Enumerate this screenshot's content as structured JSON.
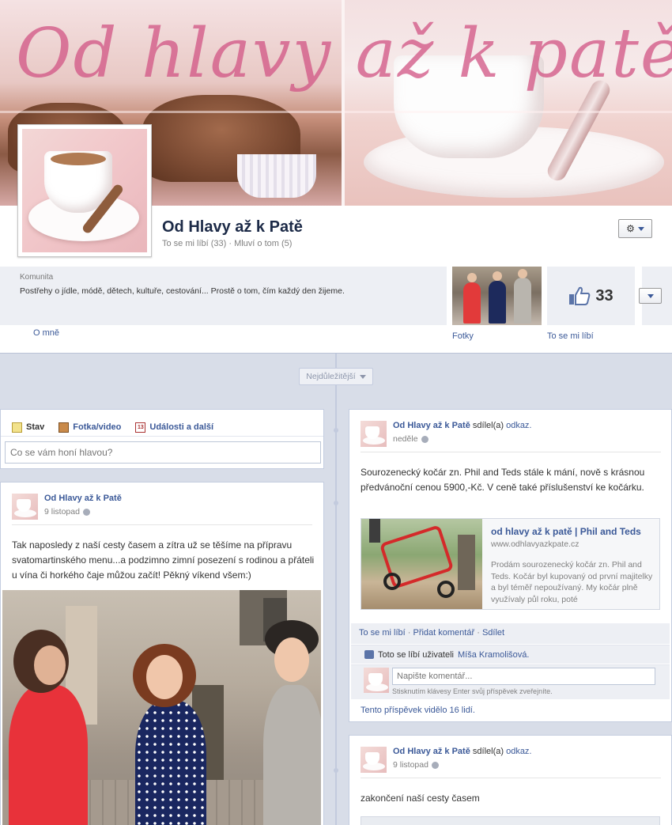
{
  "cover": {
    "title": "Od hlavy až k patě"
  },
  "page": {
    "name": "Od Hlavy až k Patě",
    "stats": "To se mi líbí (33) · Mluví o tom (5)",
    "category": "Komunita",
    "about": "Postřehy o jídle, módě, dětech, kultuře, cestování... Prostě o tom, čím každý den žijeme.",
    "about_link": "O mně",
    "photos_label": "Fotky",
    "likes_count": "33",
    "likes_label": "To se mi líbí",
    "gear_icon": "gear-icon"
  },
  "timeline": {
    "filter": "Nejdůležitější"
  },
  "composer": {
    "tabs": [
      {
        "label": "Stav",
        "icon": "status-icon"
      },
      {
        "label": "Fotka/video",
        "icon": "photo-icon"
      },
      {
        "label": "Události a další",
        "icon": "calendar-icon",
        "badge": "13"
      }
    ],
    "placeholder": "Co se vám honí hlavou?"
  },
  "posts": [
    {
      "author": "Od Hlavy až k Patě",
      "date": "9 listopad",
      "text": "Tak naposledy z naší cesty časem a zítra už se těšíme na přípravu svatomartinského menu...a podzimno zimní posezení s rodinou a přáteli u vína či horkého čaje můžou začít! Pěkný víkend všem:)"
    },
    {
      "author": "Od Hlavy až k Patě",
      "shared": "sdílel(a)",
      "shared_link": "odkaz.",
      "date": "neděle",
      "text": "Sourozenecký kočár zn. Phil and Teds stále k mání, nově s krásnou předvánoční cenou 5900,-Kč. V ceně také příslušenství ke kočárku.",
      "link_title": "od hlavy až k patě | Phil and Teds",
      "link_url": "www.odhlavyazkpate.cz",
      "link_desc": "Prodám sourozenecký kočár zn. Phil and Teds. Kočár byl kupovaný od první majitelky a byl téměř nepoužívaný. My kočár plně využívaly půl roku, poté",
      "actions": {
        "like": "To se mi líbí",
        "comment": "Přidat komentář",
        "share": "Sdílet"
      },
      "likes_prefix": "Toto se líbí uživateli",
      "likes_user": "Míša Kramolišová.",
      "comment_placeholder": "Napište komentář...",
      "comment_hint": "Stisknutím klávesy Enter svůj příspěvek zveřejníte.",
      "seen": "Tento příspěvek vidělo 16 lidí."
    },
    {
      "author": "Od Hlavy až k Patě",
      "shared": "sdílel(a)",
      "shared_link": "odkaz.",
      "date": "9 listopad",
      "text": "zakončení naší cesty časem"
    }
  ]
}
